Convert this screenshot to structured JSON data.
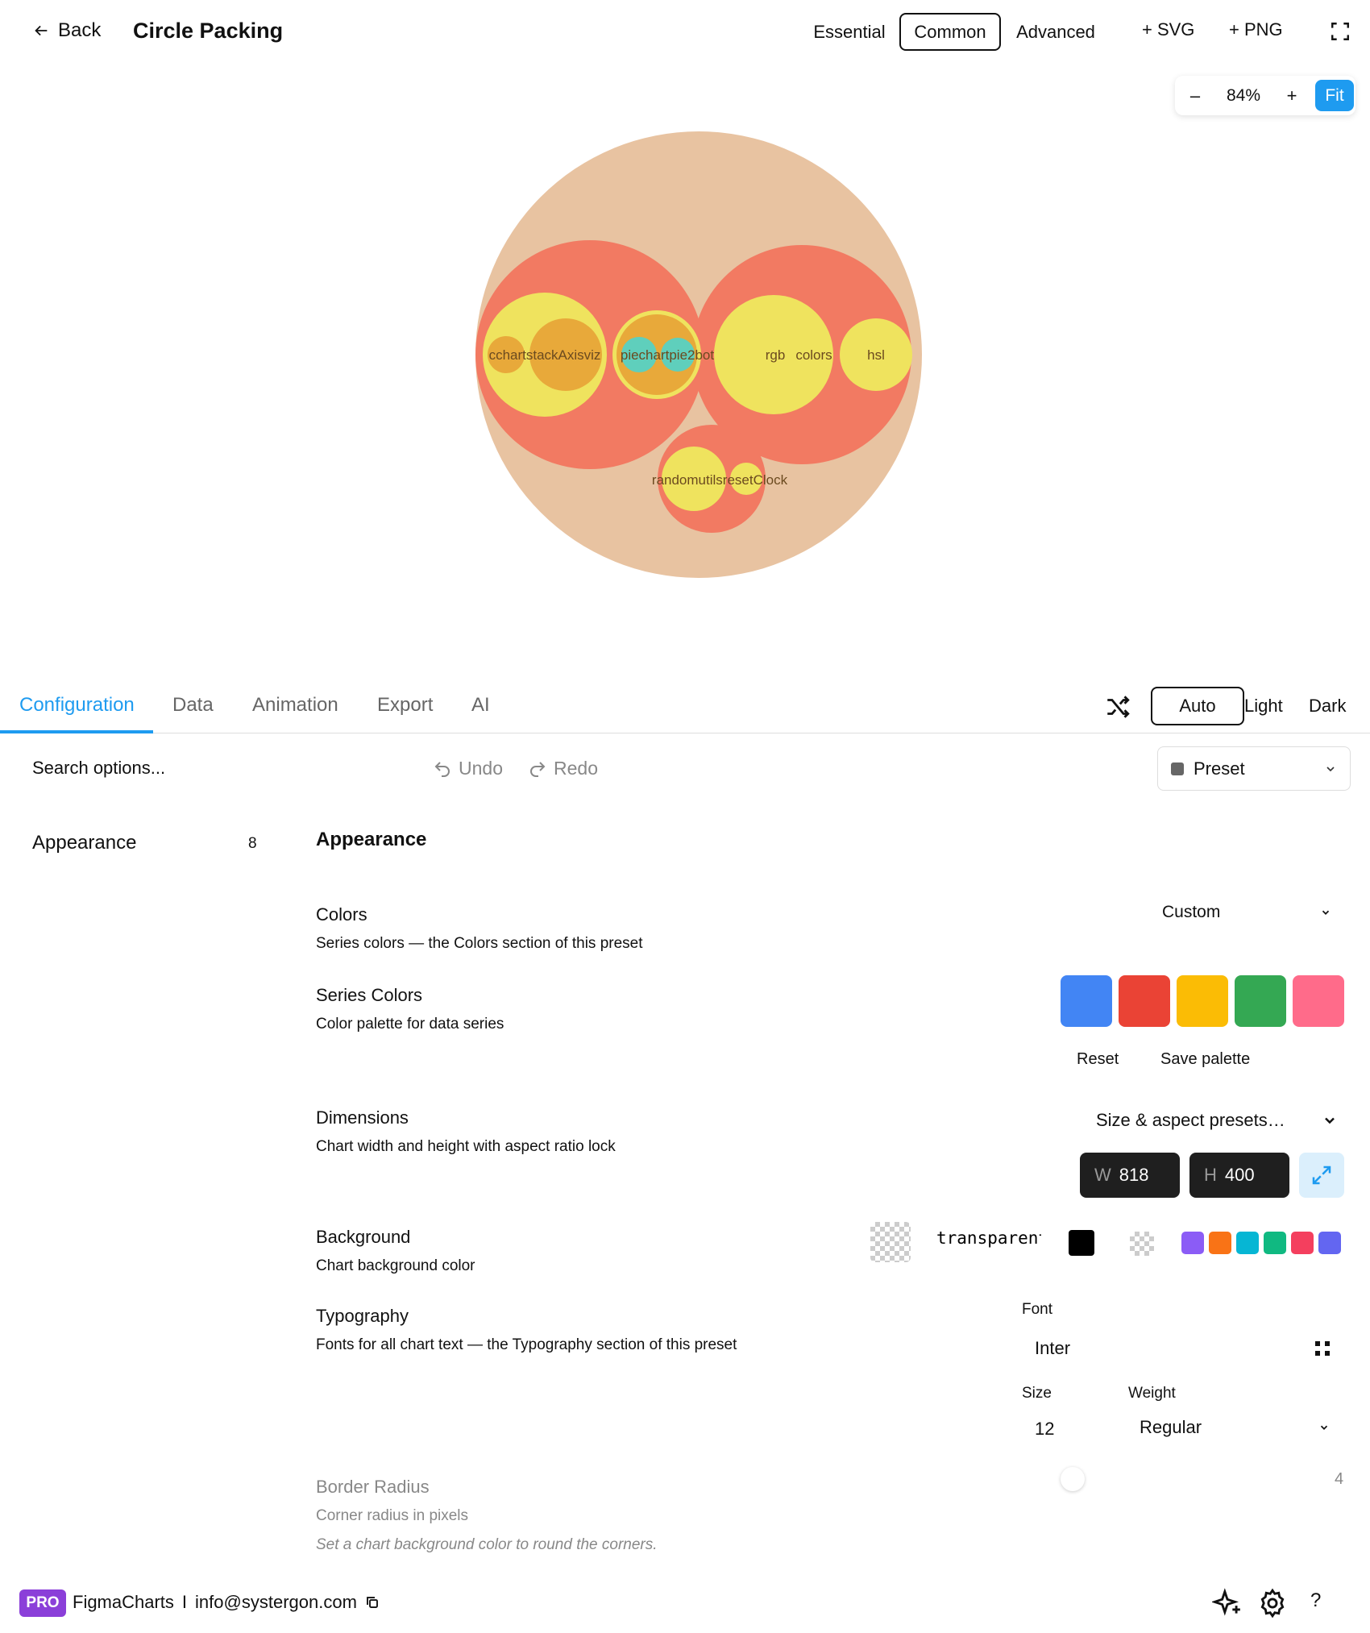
{
  "header": {
    "back_label": "Back",
    "title": "Circle Packing",
    "modes": [
      "Essential",
      "Common",
      "Advanced"
    ],
    "active_mode": "Common",
    "export_svg": "+ SVG",
    "export_png": "+ PNG"
  },
  "zoom": {
    "minus": "–",
    "value": "84%",
    "plus": "+",
    "fit": "Fit"
  },
  "chart_data": {
    "type": "circle-packing",
    "colors": {
      "root": "#e8c3a1",
      "group": "#f27a62",
      "leaf": "#efe35e",
      "inner": "#e8a93a",
      "teal": "#5fcfbc"
    },
    "labels": [
      "cchartstackAxisviz",
      "piechartpie2bot",
      "rgb",
      "colors",
      "hsl",
      "randomutilsresetClock"
    ]
  },
  "tabs": {
    "items": [
      "Configuration",
      "Data",
      "Animation",
      "Export",
      "AI"
    ],
    "active": "Configuration"
  },
  "theme": {
    "options": [
      "Auto",
      "Light",
      "Dark"
    ],
    "active": "Auto"
  },
  "toolbar": {
    "search_placeholder": "Search options...",
    "undo": "Undo",
    "redo": "Redo",
    "preset": "Preset"
  },
  "sidebar": {
    "items": [
      {
        "label": "Appearance",
        "count": "8"
      }
    ]
  },
  "section": {
    "title": "Appearance",
    "colors": {
      "label": "Colors",
      "desc": "Series colors — the Colors section of this preset",
      "value": "Custom"
    },
    "series_colors": {
      "label": "Series Colors",
      "desc": "Color palette for data series",
      "palette": [
        "#4285f4",
        "#ea4335",
        "#fbbc05",
        "#34a853",
        "#ff6b8a"
      ],
      "reset": "Reset",
      "save": "Save palette"
    },
    "dimensions": {
      "label": "Dimensions",
      "desc": "Chart width and height with aspect ratio lock",
      "presets": "Size & aspect presets…",
      "w_key": "W",
      "w_value": "818",
      "h_key": "H",
      "h_value": "400"
    },
    "background": {
      "label": "Background",
      "desc": "Chart background color",
      "value": "transparent",
      "quick_colors": [
        "#8b5cf6",
        "#f97316",
        "#06b6d4",
        "#10b981",
        "#f43f5e",
        "#6366f1"
      ]
    },
    "typography": {
      "label": "Typography",
      "desc": "Fonts for all chart text — the Typography section of this preset",
      "font_label": "Font",
      "font_value": "Inter",
      "size_label": "Size",
      "size_value": "12",
      "weight_label": "Weight",
      "weight_value": "Regular"
    },
    "border_radius": {
      "label": "Border Radius",
      "desc": "Corner radius in pixels",
      "note": "Set a chart background color to round the corners.",
      "value": "4"
    }
  },
  "footer": {
    "badge": "PRO",
    "brand": "FigmaCharts",
    "separator": "I",
    "email": "info@systergon.com"
  }
}
